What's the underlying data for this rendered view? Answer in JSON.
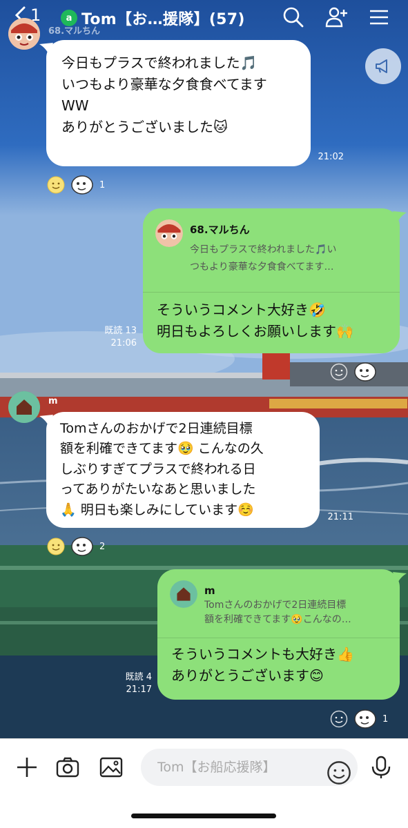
{
  "header": {
    "back_count": "1",
    "title_badge": "a",
    "title": "Tom【お…援隊】(57)",
    "icons": [
      "search-icon",
      "add-friend-icon",
      "menu-icon"
    ]
  },
  "messages": [
    {
      "type": "incoming",
      "sender": "68.マルちん",
      "text": "今日もプラスで終われました🎵\nいつもより豪華な夕食食べてます\nWW\nありがとうございました🐱",
      "time": "21:02",
      "reaction_count": "1"
    },
    {
      "type": "outgoing",
      "reply_to_name": "68.マルちん",
      "reply_to_text": "今日もプラスで終われました🎵い\nつもより豪華な夕食食べてます…",
      "text": "そういうコメント大好き🤣\n明日もよろしくお願いします🙌",
      "read": "既読 13",
      "time": "21:06"
    },
    {
      "type": "incoming",
      "sender": "m",
      "text": "Tomさんのおかげで2日連続目標\n額を利確できてます🥹 こんなの久\nしぶりすぎてプラスで終われる日\nってありがたいなあと思いました\n🙏 明日も楽しみにしています☺️",
      "time": "21:11",
      "reaction_count": "2"
    },
    {
      "type": "outgoing",
      "reply_to_name": "m",
      "reply_to_text": "Tomさんのおかげで2日連続目標\n額を利確できてます🥹こんなの…",
      "text": "そういうコメントも大好き👍\nありがとうございます😊",
      "read": "既読 4",
      "time": "21:17",
      "reaction_count": "1"
    }
  ],
  "composer": {
    "placeholder": "Tom【お船応援隊】",
    "icons": [
      "plus-icon",
      "camera-icon",
      "image-icon",
      "emoji-icon",
      "mic-icon"
    ]
  },
  "colors": {
    "accent_green": "#8de07a",
    "badge_green": "#1fb85a",
    "bubble_white": "#ffffff"
  }
}
